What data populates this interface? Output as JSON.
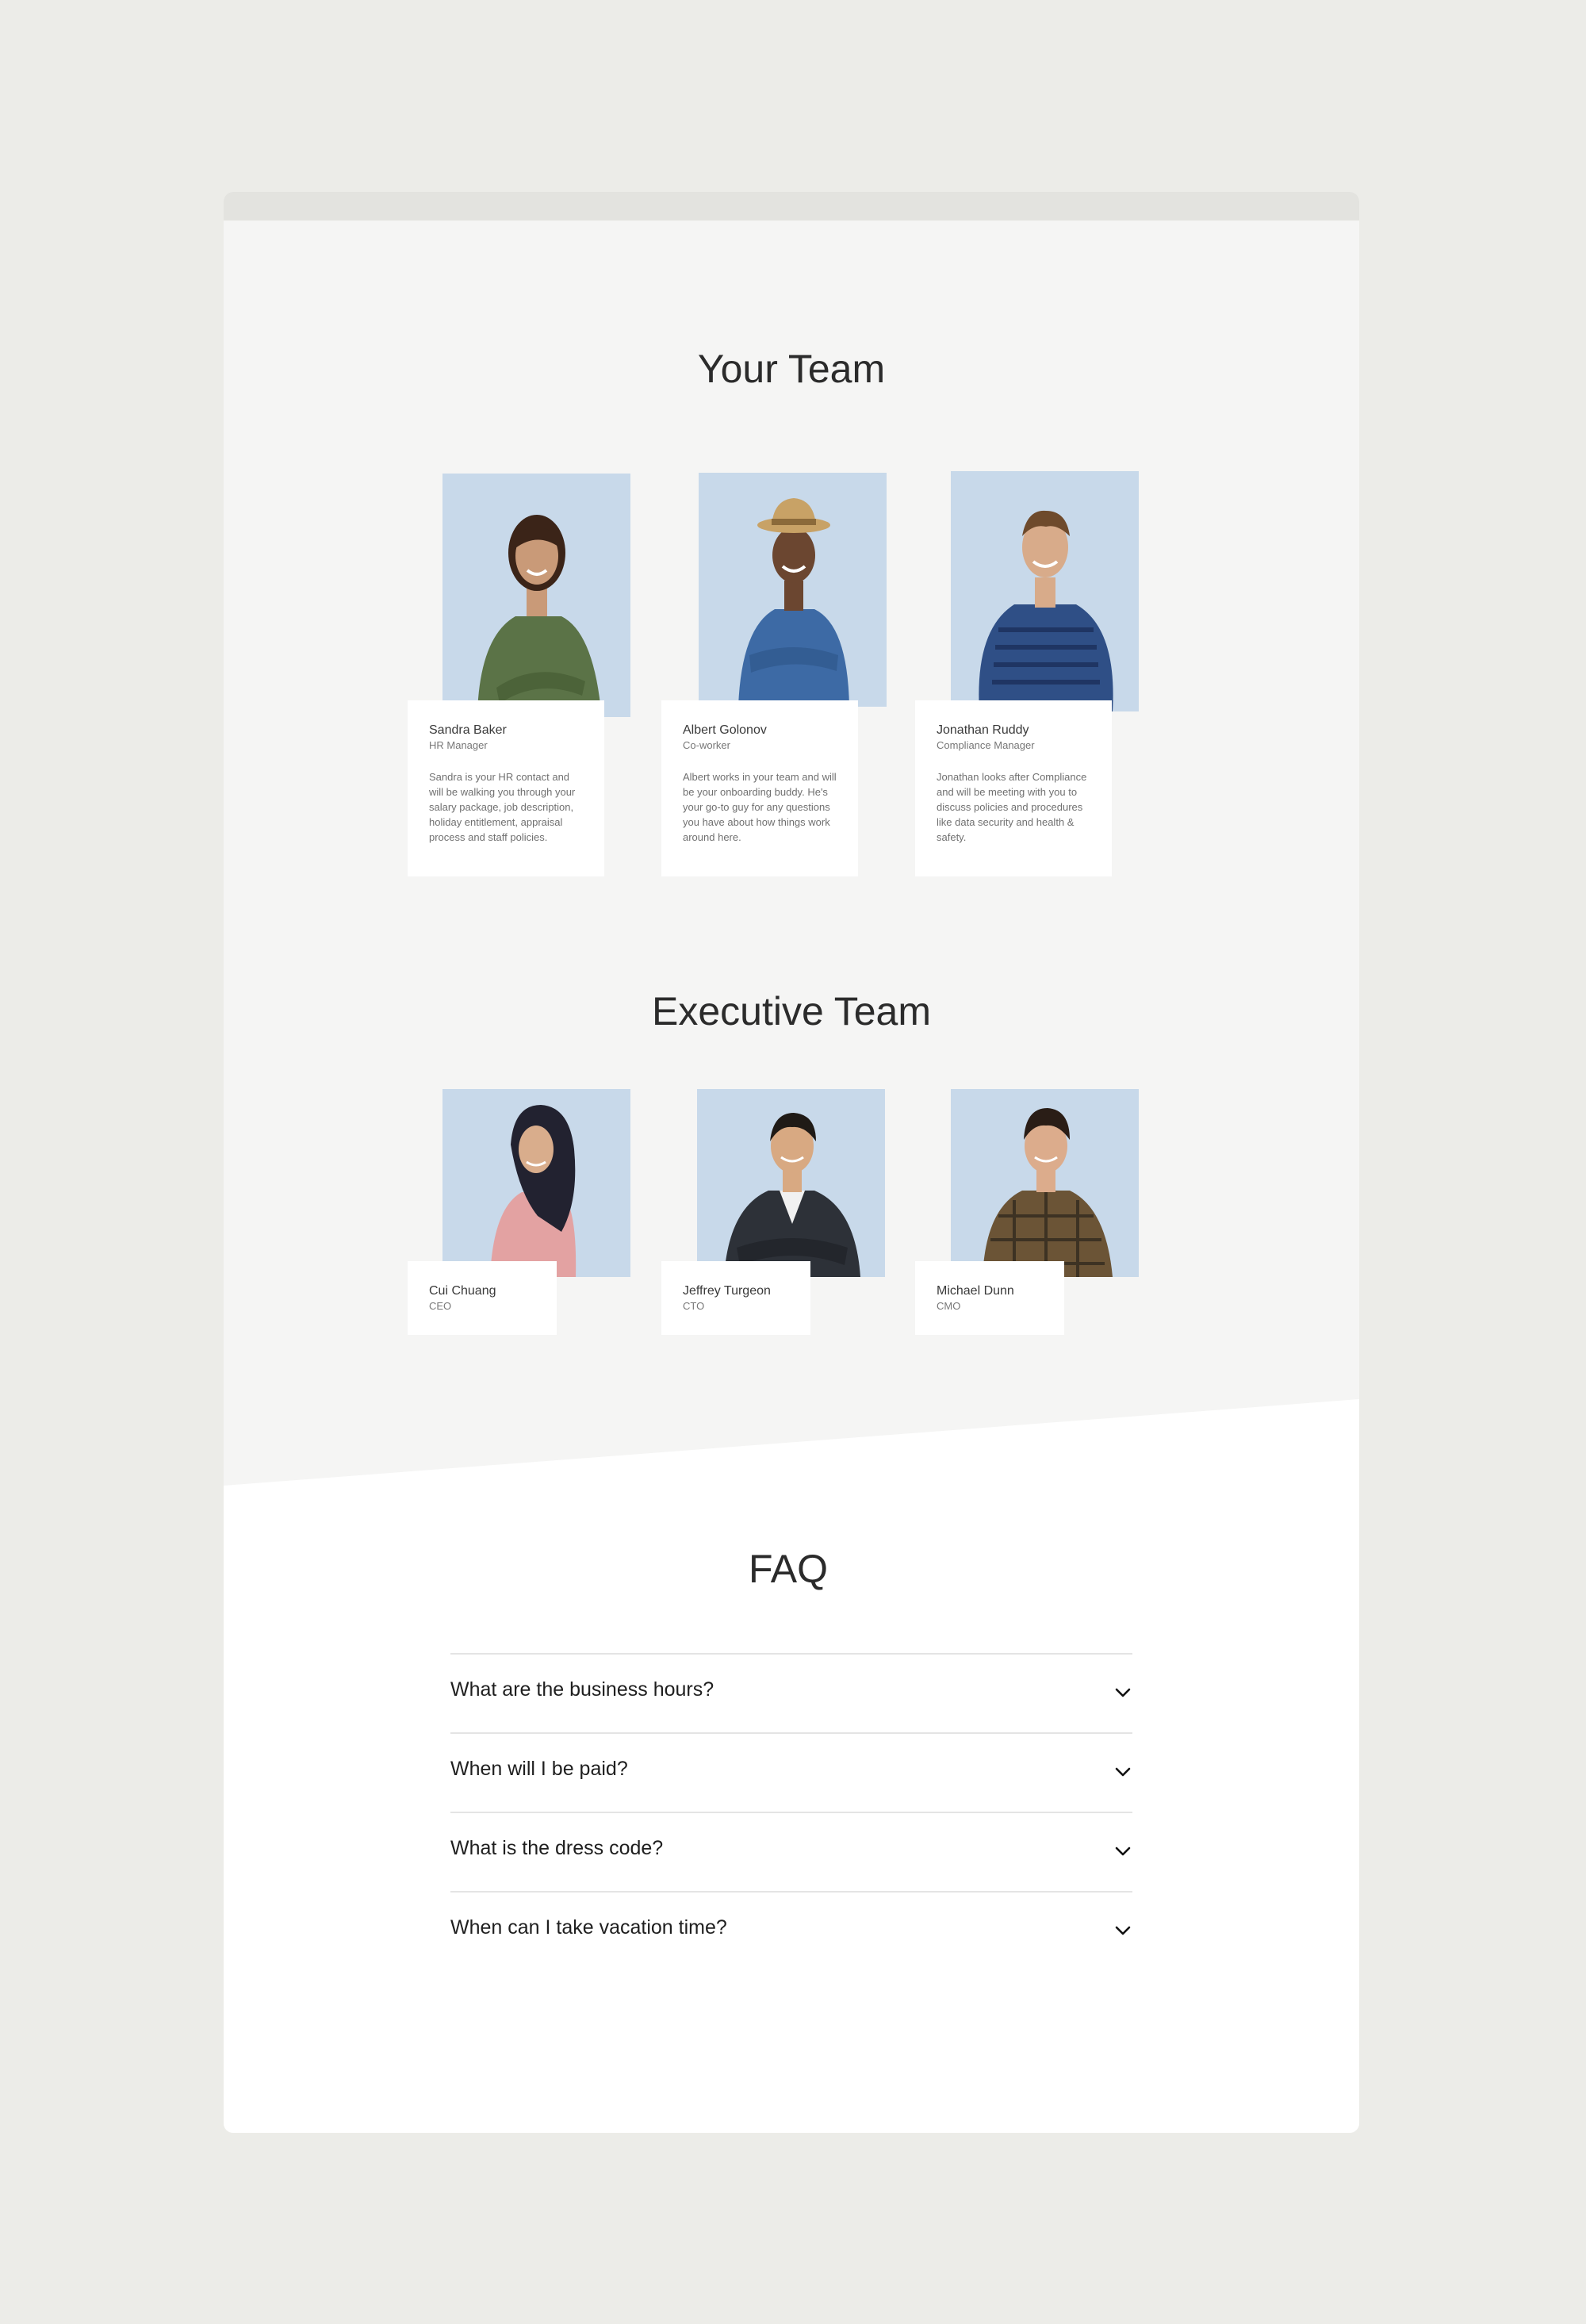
{
  "sections": {
    "your_team_title": "Your Team",
    "executive_team_title": "Executive Team",
    "faq_title": "FAQ"
  },
  "your_team": [
    {
      "name": "Sandra Baker",
      "role": "HR Manager",
      "bio": "Sandra is your HR contact and will be walking you through your salary package, job description, holiday entitlement,  appraisal process and staff policies.",
      "shirt_color": "#5b7347",
      "skin_color": "#c99a78",
      "hair_color": "#3b2418"
    },
    {
      "name": "Albert Golonov",
      "role": "Co-worker",
      "bio": "Albert works in your team and will be your onboarding buddy. He's your go-to guy for any questions you have about how things work around here.",
      "shirt_color": "#3d6aa5",
      "skin_color": "#6b4630",
      "hair_color": "#c8a266"
    },
    {
      "name": "Jonathan Ruddy",
      "role": "Compliance Manager",
      "bio": "Jonathan looks after Compliance and will be meeting with you to discuss policies and procedures like data security and health & safety.",
      "shirt_color": "#2f4f86",
      "skin_color": "#d8ab8a",
      "hair_color": "#6e4a2c"
    }
  ],
  "executive_team": [
    {
      "name": "Cui Chuang",
      "role": "CEO",
      "shirt_color": "#e3a2a2",
      "skin_color": "#d9ad8c",
      "hair_color": "#222230"
    },
    {
      "name": "Jeffrey Turgeon",
      "role": "CTO",
      "shirt_color": "#2d3138",
      "skin_color": "#d8a982",
      "hair_color": "#1f1a16"
    },
    {
      "name": "Michael Dunn",
      "role": "CMO",
      "shirt_color": "#6b5436",
      "skin_color": "#dcac8c",
      "hair_color": "#2a1d16"
    }
  ],
  "faq": [
    {
      "question": "What are the business hours?"
    },
    {
      "question": "When will I be paid?"
    },
    {
      "question": "What is the dress code?"
    },
    {
      "question": "When can I take vacation time?"
    }
  ],
  "colors": {
    "page_bg": "#ecece8",
    "panel_bg": "#f5f5f4",
    "photo_bg": "#c8d9ea",
    "card_bg": "#ffffff"
  }
}
